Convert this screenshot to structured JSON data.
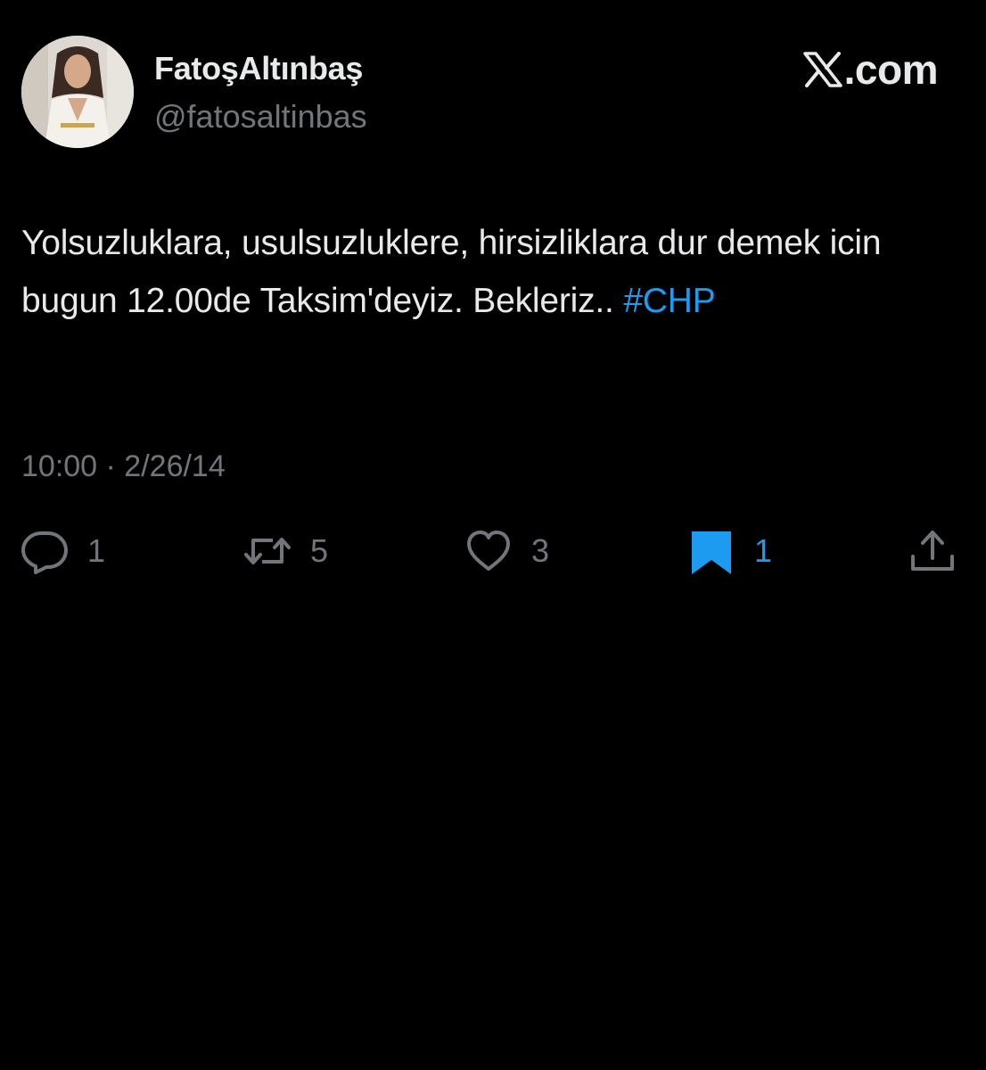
{
  "author": {
    "display_name": "FatoşAltınbaş",
    "handle": "@fatosaltinbas",
    "avatar": "profile-photo"
  },
  "brand": {
    "logo": "x-logo-icon",
    "text": ".com"
  },
  "tweet": {
    "text": "Yolsuzluklara, usulsuzluklere, hirsizliklara dur demek icin bugun 12.00de Taksim'deyiz. Bekleriz.. ",
    "hashtag": "#CHP",
    "timestamp": "10:00 · 2/26/14"
  },
  "actions": {
    "reply": {
      "icon": "reply-icon",
      "count": "1"
    },
    "retweet": {
      "icon": "retweet-icon",
      "count": "5"
    },
    "like": {
      "icon": "heart-icon",
      "count": "3"
    },
    "bookmark": {
      "icon": "bookmark-icon",
      "count": "1",
      "active": true
    },
    "share": {
      "icon": "share-icon"
    }
  },
  "colors": {
    "background": "#000000",
    "primary_text": "#e7e9ea",
    "secondary_text": "#71767b",
    "accent": "#1d9bf0"
  }
}
